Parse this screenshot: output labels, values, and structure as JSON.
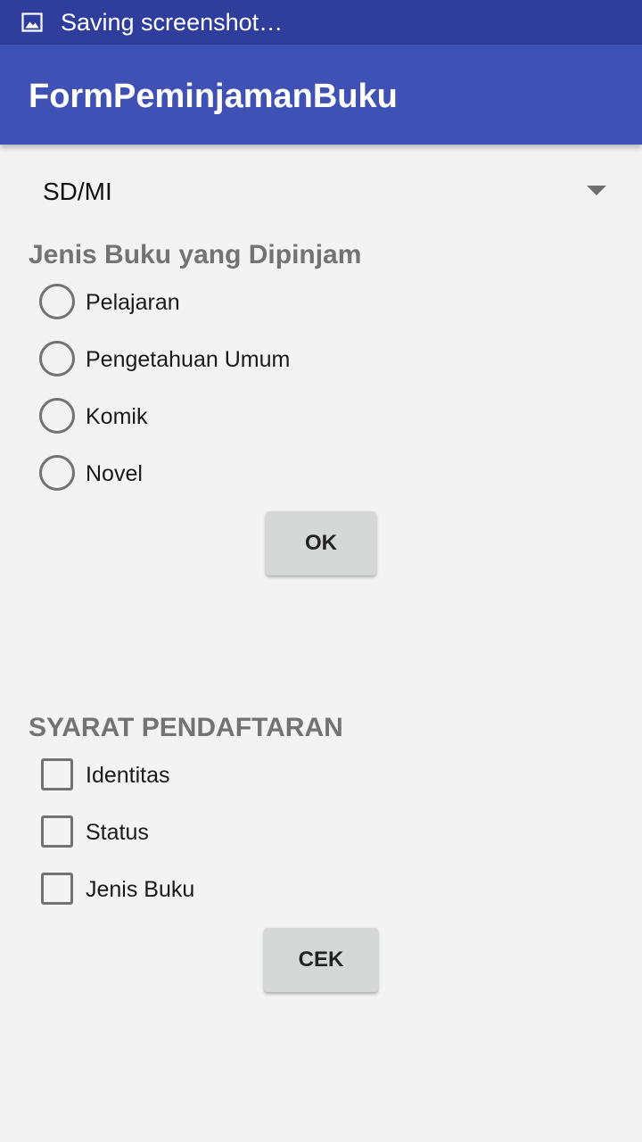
{
  "status_bar": {
    "icon": "image-icon",
    "text": "Saving screenshot…",
    "background": "#2f3e9d"
  },
  "app_bar": {
    "title": "FormPeminjamanBuku",
    "background": "#3f51b5"
  },
  "spinner": {
    "selected_value": "SD/MI"
  },
  "radio_group": {
    "title": "Jenis Buku yang Dipinjam",
    "options": [
      {
        "label": "Pelajaran",
        "selected": false
      },
      {
        "label": "Pengetahuan Umum",
        "selected": false
      },
      {
        "label": "Komik",
        "selected": false
      },
      {
        "label": "Novel",
        "selected": false
      }
    ]
  },
  "ok_button": {
    "label": "OK"
  },
  "checkbox_group": {
    "title": "SYARAT PENDAFTARAN",
    "options": [
      {
        "label": "Identitas",
        "checked": false
      },
      {
        "label": "Status",
        "checked": false
      },
      {
        "label": "Jenis Buku",
        "checked": false
      }
    ]
  },
  "cek_button": {
    "label": "CEK"
  }
}
